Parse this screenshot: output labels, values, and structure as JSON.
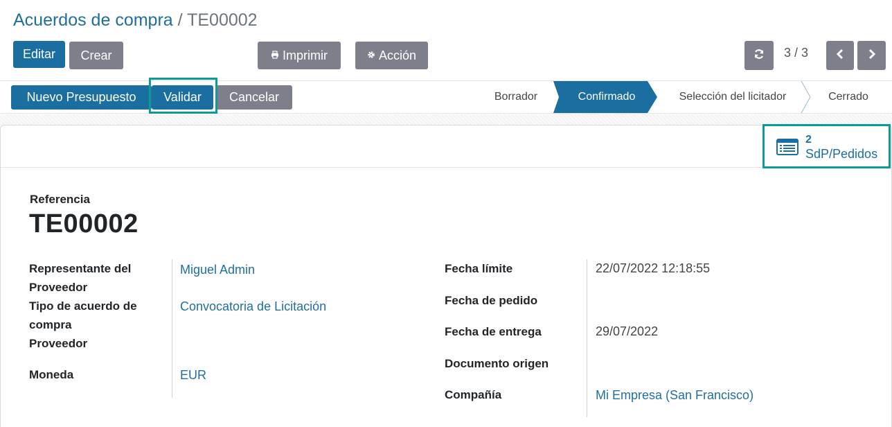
{
  "breadcrumb": {
    "parent": "Acuerdos de compra",
    "separator": "/",
    "current": "TE00002"
  },
  "toolbar": {
    "edit": "Editar",
    "create": "Crear",
    "print": "Imprimir",
    "action": "Acción",
    "print_icon": "printer-icon",
    "action_icon": "gear-icon"
  },
  "pager": {
    "text": "3 / 3",
    "refresh_icon": "refresh-icon",
    "prev_icon": "chevron-left-icon",
    "next_icon": "chevron-right-icon"
  },
  "statusbar": {
    "buttons": {
      "new_quote": "Nuevo Presupuesto",
      "validate": "Validar",
      "cancel": "Cancelar"
    },
    "stages": [
      "Borrador",
      "Confirmado",
      "Selección del licitador",
      "Cerrado"
    ],
    "active_stage": "Confirmado"
  },
  "smart_button": {
    "count": "2",
    "label": "SdP/Pedidos",
    "icon": "list-icon"
  },
  "form": {
    "reference_label": "Referencia",
    "reference_value": "TE00002",
    "left_fields": [
      {
        "label_line1": "Representante del",
        "label_line2": "Proveedor",
        "value": "Miguel Admin"
      },
      {
        "label_line1": "Tipo de acuerdo de",
        "label_line2": "compra",
        "value": "Convocatoria de Licitación"
      },
      {
        "label": "Proveedor",
        "value": ""
      },
      {
        "label": "Moneda",
        "value": "EUR"
      }
    ],
    "right_fields": [
      {
        "label": "Fecha límite",
        "value": "22/07/2022 12:18:55"
      },
      {
        "label": "Fecha de pedido",
        "value": ""
      },
      {
        "label": "Fecha de entrega",
        "value": "29/07/2022"
      },
      {
        "label": "Documento origen",
        "value": ""
      },
      {
        "label": "Compañía",
        "value": "Mi Empresa (San Francisco)"
      }
    ]
  },
  "colors": {
    "primary": "#1a6fa0",
    "secondary": "#7d7f8b",
    "link": "#1f6f9c",
    "highlight": "#0e9a97"
  }
}
